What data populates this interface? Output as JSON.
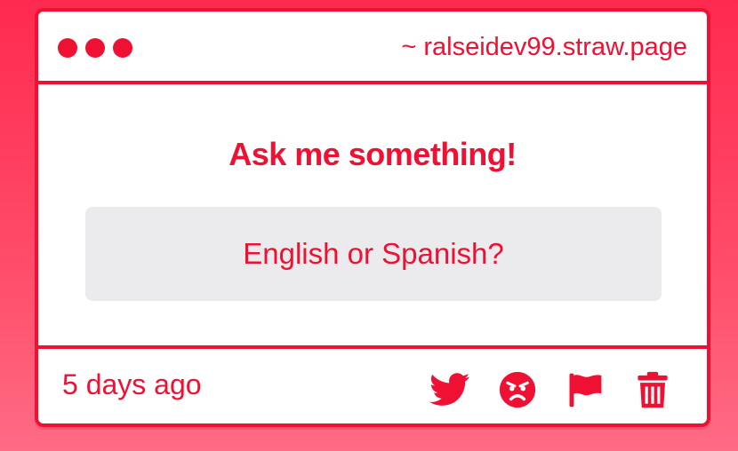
{
  "window": {
    "url": "~ ralseidev99.straw.page"
  },
  "main": {
    "heading": "Ask me something!",
    "question": "English or Spanish?"
  },
  "footer": {
    "timestamp": "5 days ago",
    "actions": [
      {
        "icon": "twitter-icon"
      },
      {
        "icon": "angry-face-icon"
      },
      {
        "icon": "flag-icon"
      },
      {
        "icon": "trash-icon"
      }
    ]
  },
  "colors": {
    "accent": "#ee1133",
    "background_gradient_top": "#ff2a4f",
    "background_gradient_bottom": "#ff6b84",
    "question_box_bg": "#ebeaec"
  }
}
